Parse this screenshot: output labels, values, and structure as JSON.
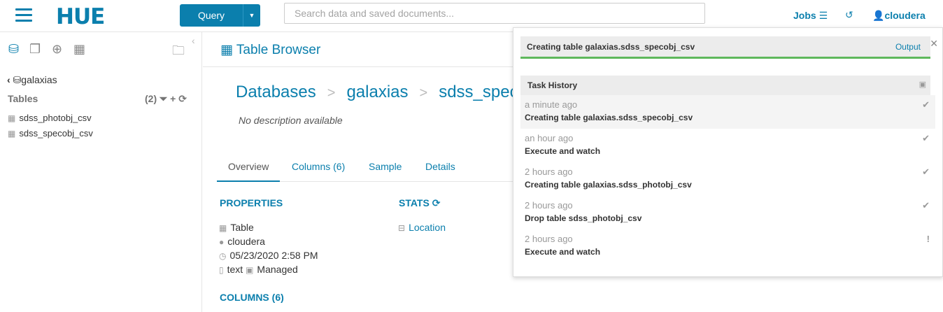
{
  "topbar": {
    "logo": "HUE",
    "query_label": "Query",
    "search_placeholder": "Search data and saved documents...",
    "jobs_label": "Jobs",
    "user_label": "cloudera"
  },
  "left_panel": {
    "database": "galaxias",
    "tables_label": "Tables",
    "tables_count": "(2)",
    "tables": [
      "sdss_photobj_csv",
      "sdss_specobj_csv"
    ]
  },
  "main": {
    "title": "Table Browser",
    "breadcrumb": [
      "Databases",
      "galaxias",
      "sdss_specobj_csv"
    ],
    "description": "No description available",
    "tabs": [
      "Overview",
      "Columns (6)",
      "Sample",
      "Details"
    ],
    "properties_heading": "PROPERTIES",
    "stats_heading": "STATS",
    "properties": {
      "type": "Table",
      "owner": "cloudera",
      "created": "05/23/2020 2:58 PM",
      "format": "text",
      "managed": "Managed"
    },
    "location_label": "Location",
    "columns_heading": "COLUMNS (6)"
  },
  "jobs_panel": {
    "running_task": "Creating table galaxias.sdss_specobj_csv",
    "output_label": "Output",
    "history_title": "Task History",
    "history": [
      {
        "time": "a minute ago",
        "name": "Creating table galaxias.sdss_specobj_csv",
        "status": "✔"
      },
      {
        "time": "an hour ago",
        "name": "Execute and watch",
        "status": "✔"
      },
      {
        "time": "2 hours ago",
        "name": "Creating table galaxias.sdss_photobj_csv",
        "status": "✔"
      },
      {
        "time": "2 hours ago",
        "name": "Drop table sdss_photobj_csv",
        "status": "✔"
      },
      {
        "time": "2 hours ago",
        "name": "Execute and watch",
        "status": "!"
      }
    ]
  },
  "colors": {
    "accent": "#0B7FAD",
    "success": "#5fb85c"
  }
}
